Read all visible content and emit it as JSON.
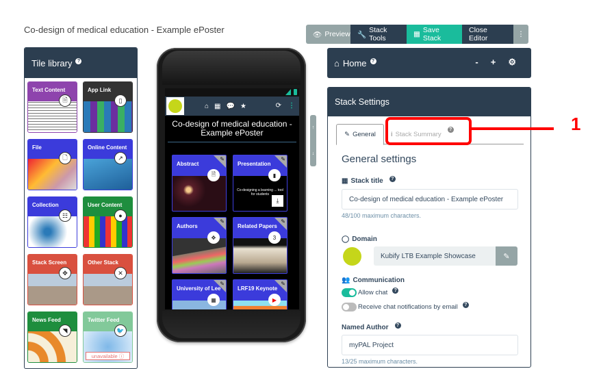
{
  "page": {
    "title": "Co-design of medical education - Example ePoster"
  },
  "toolbar": {
    "preview": "Preview",
    "stack_tools": "Stack Tools",
    "save_stack": "Save Stack",
    "close_editor": "Close Editor",
    "more": "⋮"
  },
  "tile_library": {
    "title": "Tile library",
    "help": "?",
    "tiles": [
      {
        "label": "Text Content",
        "icon": "file-text-icon",
        "glyph": "🗎",
        "color": "#8e44ad"
      },
      {
        "label": "App Link",
        "icon": "mobile-icon",
        "glyph": "▯",
        "color": "#333333"
      },
      {
        "label": "File",
        "icon": "file-icon",
        "glyph": "🗋",
        "color": "#3b3bdb"
      },
      {
        "label": "Online Content",
        "icon": "external-link-icon",
        "glyph": "↗",
        "color": "#3b3bdb"
      },
      {
        "label": "Collection",
        "icon": "list-icon",
        "glyph": "☷",
        "color": "#3b3bdb"
      },
      {
        "label": "User Content",
        "icon": "user-icon",
        "glyph": "●",
        "color": "#1e8e3e"
      },
      {
        "label": "Stack Screen",
        "icon": "move-icon",
        "glyph": "✥",
        "color": "#d9503f"
      },
      {
        "label": "Other Stack",
        "icon": "expand-icon",
        "glyph": "✕",
        "color": "#d9503f"
      },
      {
        "label": "News Feed",
        "icon": "rss-icon",
        "glyph": "◥",
        "color": "#1e8e3e"
      },
      {
        "label": "Twitter Feed",
        "icon": "twitter-icon",
        "glyph": "🐦",
        "color": "#82c99a",
        "badge": "unavailable ⓘ"
      }
    ]
  },
  "phone": {
    "screen_title": "Co-design of medical education - Example ePoster",
    "nav_icons": [
      "home-icon",
      "grid-icon",
      "chat-icon",
      "star-icon"
    ],
    "tiles": [
      {
        "label": "Abstract",
        "icon": "file-text-icon",
        "glyph": "🗎"
      },
      {
        "label": "Presentation",
        "icon": "file-icon",
        "glyph": "▮",
        "download": true,
        "preview_lines": [
          "Co-designing a learning ... tool for students"
        ]
      },
      {
        "label": "Authors",
        "icon": "move-icon",
        "glyph": "✥"
      },
      {
        "label": "Related Papers",
        "icon": "count-badge",
        "glyph": "3"
      },
      {
        "label": "University of Lee",
        "icon": "building-icon",
        "glyph": "▦",
        "external": true
      },
      {
        "label": "LRF19 Keynote",
        "icon": "youtube-icon",
        "glyph": "▶",
        "external": true
      }
    ]
  },
  "home_panel": {
    "title": "Home",
    "help": "?",
    "minus": "-",
    "plus": "+",
    "gear": "⚙"
  },
  "settings": {
    "title": "Stack Settings",
    "tabs": [
      {
        "label": "General",
        "active": true
      },
      {
        "label": "Stack Summary",
        "active": false
      }
    ],
    "section_title": "General settings",
    "stack_title_label": "Stack title",
    "stack_title_value": "Co-design of medical education - Example ePoster",
    "stack_title_hint": "48/100 maximum characters.",
    "domain_label": "Domain",
    "domain_value": "Kubify LTB Example Showcase",
    "communication_label": "Communication",
    "allow_chat_label": "Allow chat",
    "allow_chat": true,
    "email_notify_label": "Receive chat notifications by email",
    "email_notify": false,
    "author_label": "Named Author",
    "author_value": "myPAL Project",
    "author_hint": "13/25 maximum characters."
  },
  "annotation": {
    "number": "1",
    "color": "#ff0000"
  }
}
